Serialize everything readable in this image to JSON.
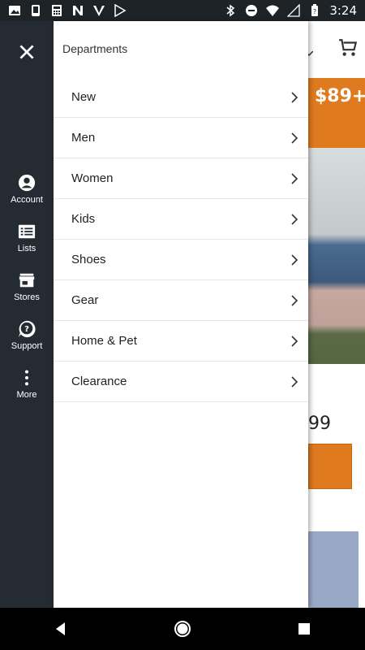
{
  "status_bar": {
    "time": "3:24",
    "left_icons": [
      "image-icon",
      "phone-icon",
      "calculator-icon",
      "n-app-icon",
      "feedly-icon",
      "play-store-icon"
    ],
    "right_icons": [
      "bluetooth-icon",
      "do-not-disturb-icon",
      "wifi-icon",
      "signal-icon",
      "battery-icon"
    ]
  },
  "background": {
    "promo_text": "$89+",
    "price_fragment": "99"
  },
  "rail": {
    "close_icon": "close-icon",
    "items": [
      {
        "label": "Account",
        "icon": "account-icon"
      },
      {
        "label": "Lists",
        "icon": "list-icon"
      },
      {
        "label": "Stores",
        "icon": "store-icon"
      },
      {
        "label": "Support",
        "icon": "support-icon"
      },
      {
        "label": "More",
        "icon": "more-icon"
      }
    ]
  },
  "drawer": {
    "title": "Departments",
    "items": [
      {
        "label": "New"
      },
      {
        "label": "Men"
      },
      {
        "label": "Women"
      },
      {
        "label": "Kids"
      },
      {
        "label": "Shoes"
      },
      {
        "label": "Gear"
      },
      {
        "label": "Home & Pet"
      },
      {
        "label": "Clearance"
      }
    ]
  },
  "nav_bar": {
    "buttons": [
      "back-icon",
      "home-icon",
      "recents-icon"
    ]
  },
  "colors": {
    "rail_bg": "#252b33",
    "accent_orange": "#e07a1f",
    "status_bg": "#1e2328"
  }
}
